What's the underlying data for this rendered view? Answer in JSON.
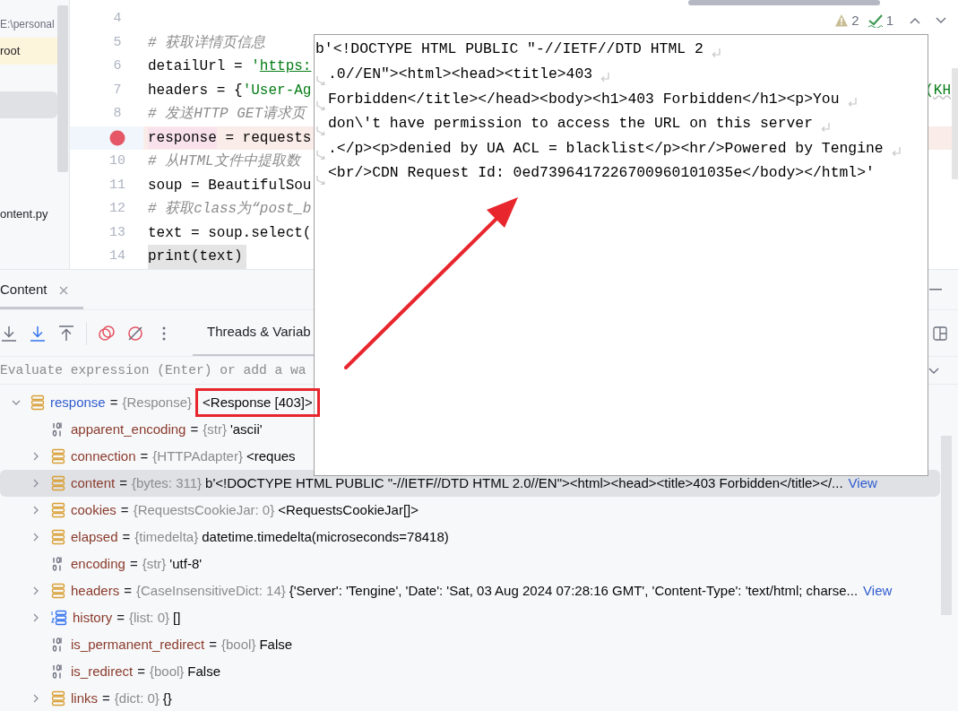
{
  "sidebar": {
    "items": [
      {
        "text": "E:\\personal",
        "kind": "plain"
      },
      {
        "text": "root",
        "kind": "marked"
      },
      {
        "kind": "selection"
      },
      {
        "text": "ontent.py",
        "kind": "plain"
      }
    ]
  },
  "editor": {
    "inspections": {
      "warnings": "2",
      "passed": "1"
    },
    "lines": [
      {
        "number": "4",
        "breakpoint": false,
        "selected": false
      },
      {
        "number": "5",
        "breakpoint": false,
        "selected": false,
        "segments": [
          {
            "text": "# 获取详情页信息",
            "kind": "comment"
          }
        ]
      },
      {
        "number": "6",
        "breakpoint": false,
        "selected": false,
        "segments": [
          {
            "text": "detailUrl = ",
            "kind": "plain"
          },
          {
            "text": "'",
            "kind": "string"
          },
          {
            "text": "https:",
            "kind": "url"
          }
        ]
      },
      {
        "number": "7",
        "breakpoint": false,
        "selected": false,
        "segments": [
          {
            "text": "headers = {",
            "kind": "plain"
          },
          {
            "text": "'User-Ag",
            "kind": "string"
          }
        ],
        "tail": "(KH"
      },
      {
        "number": "8",
        "breakpoint": false,
        "selected": false,
        "segments": [
          {
            "text": "# 发送HTTP GET请求页",
            "kind": "comment"
          }
        ]
      },
      {
        "breakpoint": true,
        "selected": false,
        "segments": [
          {
            "text": "response",
            "kind": "usage"
          },
          {
            "text": " = requests",
            "kind": "plain"
          }
        ]
      },
      {
        "number": "10",
        "breakpoint": false,
        "selected": false,
        "segments": [
          {
            "text": "# 从HTML文件中提取数",
            "kind": "comment"
          }
        ]
      },
      {
        "number": "11",
        "breakpoint": false,
        "selected": false,
        "segments": [
          {
            "text": "soup = BeautifulSou",
            "kind": "plain"
          }
        ]
      },
      {
        "number": "12",
        "breakpoint": false,
        "selected": false,
        "segments": [
          {
            "text": "# 获取class为“post_b",
            "kind": "comment"
          }
        ]
      },
      {
        "number": "13",
        "breakpoint": false,
        "selected": false,
        "segments": [
          {
            "text": "text = soup.select(",
            "kind": "plain"
          }
        ]
      },
      {
        "number": "14",
        "breakpoint": false,
        "selected": true,
        "segments": [
          {
            "text": "print(text)",
            "kind": "plain"
          }
        ]
      }
    ]
  },
  "popup": {
    "lines": [
      {
        "text": "b'<!DOCTYPE HTML PUBLIC \"-//IETF//DTD HTML 2",
        "continued": false,
        "wraps": true
      },
      {
        "text": ".0//EN\"><html><head><title>403",
        "continued": true,
        "wraps": true
      },
      {
        "text": "Forbidden</title></head><body><h1>403 Forbidden</h1><p>You",
        "continued": true,
        "wraps": true
      },
      {
        "text": "don\\'t have permission to access the URL on this server",
        "continued": true,
        "wraps": true
      },
      {
        "text": ".</p><p>denied by UA ACL = blacklist</p><hr/>Powered by Tengine",
        "continued": true,
        "wraps": true
      },
      {
        "text": "<br/>CDN Request Id: 0ed7396417226700960101035e</body></html>'",
        "continued": true,
        "wraps": false
      }
    ]
  },
  "debug": {
    "tab": {
      "label": "Content",
      "selected": true
    },
    "variables_tab": {
      "label": "Threads & Variab",
      "selected": true
    },
    "evaluate": {
      "placeholder": "Evaluate expression (Enter) or add a wa"
    },
    "variables": [
      {
        "name": "response",
        "sep": "=",
        "type": "{Response}",
        "value": "<Response [403]>",
        "kind": "object",
        "expanded": true,
        "selected": false,
        "boxed": true,
        "children": [
          {
            "name": "apparent_encoding",
            "sep": "=",
            "type": "{str}",
            "value": "'ascii'",
            "kind": "primitive",
            "selected": false
          },
          {
            "name": "connection",
            "sep": "=",
            "type": "{HTTPAdapter}",
            "value": "<reques",
            "kind": "object",
            "expanded": false,
            "selected": false
          },
          {
            "name": "content",
            "sep": "=",
            "type": "{bytes: 311}",
            "value": "b'<!DOCTYPE HTML PUBLIC \"-//IETF//DTD HTML 2.0//EN\"><html><head><title>403 Forbidden</title></...",
            "link": "View",
            "kind": "object",
            "expanded": false,
            "selected": true
          },
          {
            "name": "cookies",
            "sep": "=",
            "type": "{RequestsCookieJar: 0}",
            "value": "<RequestsCookieJar[]>",
            "kind": "object",
            "expanded": false,
            "selected": false
          },
          {
            "name": "elapsed",
            "sep": "=",
            "type": "{timedelta}",
            "value": "datetime.timedelta(microseconds=78418)",
            "kind": "object",
            "expanded": false,
            "selected": false
          },
          {
            "name": "encoding",
            "sep": "=",
            "type": "{str}",
            "value": "'utf-8'",
            "kind": "primitive",
            "selected": false
          },
          {
            "name": "headers",
            "sep": "=",
            "type": "{CaseInsensitiveDict: 14}",
            "value": "{'Server': 'Tengine', 'Date': 'Sat, 03 Aug 2024 07:28:16 GMT', 'Content-Type': 'text/html; charse...",
            "link": "View",
            "kind": "object",
            "expanded": false,
            "selected": false
          },
          {
            "name": "history",
            "sep": "=",
            "type": "{list: 0}",
            "value": "[]",
            "kind": "list",
            "expanded": false,
            "selected": false
          },
          {
            "name": "is_permanent_redirect",
            "sep": "=",
            "type": "{bool}",
            "value": "False",
            "kind": "primitive",
            "selected": false
          },
          {
            "name": "is_redirect",
            "sep": "=",
            "type": "{bool}",
            "value": "False",
            "kind": "primitive",
            "selected": false
          },
          {
            "name": "links",
            "sep": "=",
            "type": "{dict: 0}",
            "value": "{}",
            "kind": "object",
            "expanded": false,
            "selected": false
          }
        ]
      }
    ]
  },
  "annotations": [
    {
      "kind": "arrow"
    }
  ]
}
